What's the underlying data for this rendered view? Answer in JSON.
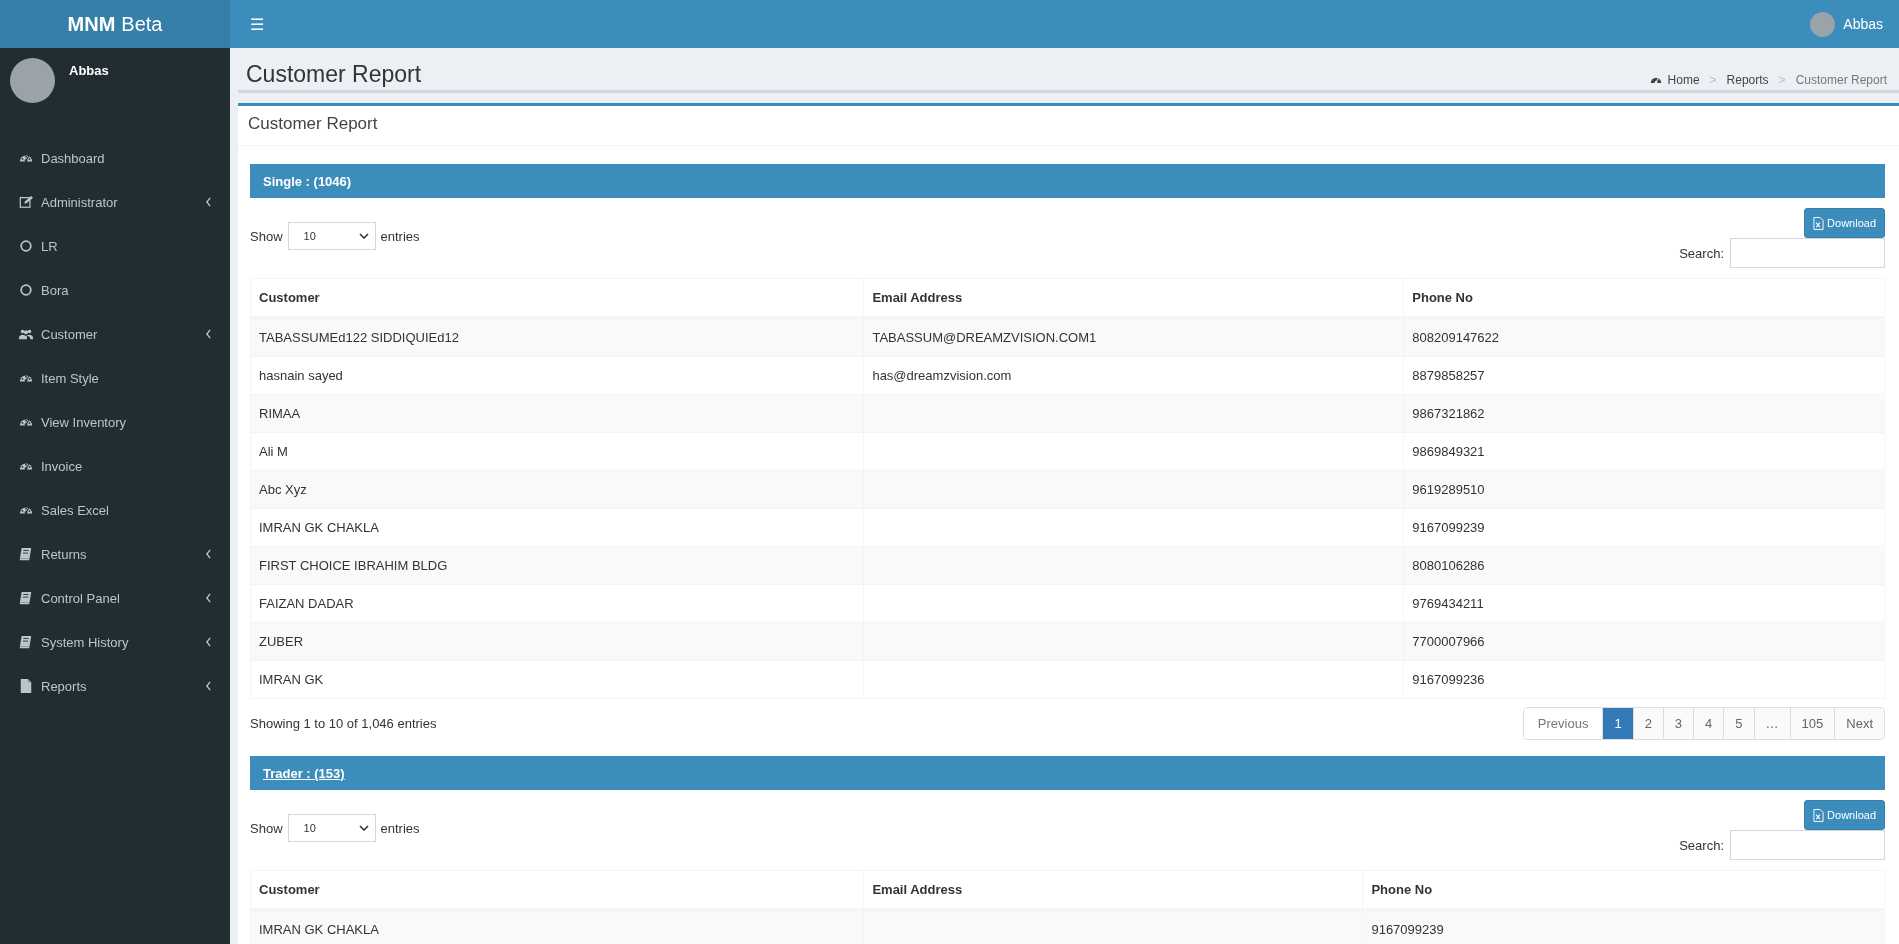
{
  "header": {
    "logo_bold": "MNM",
    "logo_light": "Beta",
    "menu_toggle": "☰",
    "user_name": "Abbas"
  },
  "sidebar": {
    "user_name": "Abbas",
    "items": [
      {
        "label": "Dashboard",
        "collapsible": false
      },
      {
        "label": "Administrator",
        "collapsible": true
      },
      {
        "label": "LR",
        "collapsible": false
      },
      {
        "label": "Bora",
        "collapsible": false
      },
      {
        "label": "Customer",
        "collapsible": true
      },
      {
        "label": "Item Style",
        "collapsible": false
      },
      {
        "label": "View Inventory",
        "collapsible": false
      },
      {
        "label": "Invoice",
        "collapsible": false
      },
      {
        "label": "Sales Excel",
        "collapsible": false
      },
      {
        "label": "Returns",
        "collapsible": true
      },
      {
        "label": "Control Panel",
        "collapsible": true
      },
      {
        "label": "System History",
        "collapsible": true
      },
      {
        "label": "Reports",
        "collapsible": true
      }
    ]
  },
  "page": {
    "title": "Customer Report",
    "breadcrumb": [
      "Home",
      "Reports",
      "Customer Report"
    ],
    "breadcrumb_separator": ">",
    "box_title": "Customer Report"
  },
  "sections": [
    {
      "title": "Single : (1046)",
      "underlined": false,
      "download": "Download",
      "show_label": "Show",
      "page_size": "10",
      "entries_label": "entries",
      "search_label": "Search:",
      "columns": [
        "Customer",
        "Email Address",
        "Phone No"
      ],
      "rows": [
        [
          "TABASSUMEd122 SIDDIQUIEd12",
          "TABASSUM@DREAMZVISION.COM1",
          "808209147622"
        ],
        [
          "hasnain sayed",
          "has@dreamzvision.com",
          "8879858257"
        ],
        [
          "RIMAA",
          "",
          "9867321862"
        ],
        [
          "Ali M",
          "",
          "9869849321"
        ],
        [
          "Abc Xyz",
          "",
          "9619289510"
        ],
        [
          "IMRAN GK CHAKLA",
          "",
          "9167099239"
        ],
        [
          "FIRST CHOICE IBRAHIM BLDG",
          "",
          "8080106286"
        ],
        [
          "FAIZAN DADAR",
          "",
          "9769434211"
        ],
        [
          "ZUBER",
          "",
          "7700007966"
        ],
        [
          "IMRAN GK",
          "",
          "9167099236"
        ]
      ],
      "info": "Showing 1 to 10 of 1,046 entries",
      "pagination": [
        {
          "label": "Previous",
          "selected": false
        },
        {
          "label": "1",
          "selected": true
        },
        {
          "label": "2",
          "selected": false
        },
        {
          "label": "3",
          "selected": false
        },
        {
          "label": "4",
          "selected": false
        },
        {
          "label": "5",
          "selected": false
        },
        {
          "label": "…",
          "selected": false
        },
        {
          "label": "105",
          "selected": false
        },
        {
          "label": "Next",
          "selected": false
        }
      ]
    },
    {
      "title": "Trader : (153)",
      "underlined": true,
      "download": "Download",
      "show_label": "Show",
      "page_size": "10",
      "entries_label": "entries",
      "search_label": "Search:",
      "columns": [
        "Customer",
        "Email Address",
        "Phone No"
      ],
      "rows": [
        [
          "IMRAN GK CHAKLA",
          "",
          "9167099239"
        ]
      ]
    }
  ]
}
